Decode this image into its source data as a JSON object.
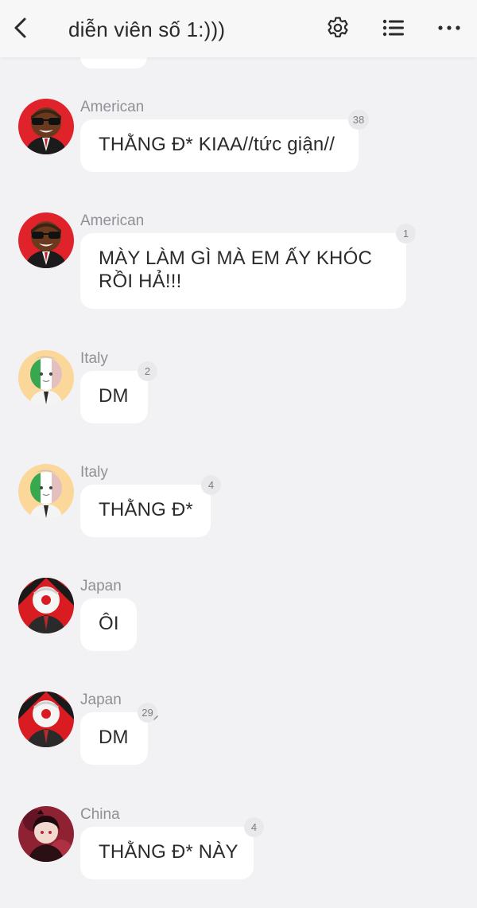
{
  "header": {
    "title": "diễn viên số 1:)))",
    "icons": [
      "back-arrow-icon",
      "gear-icon",
      "list-icon",
      "more-dots-icon"
    ]
  },
  "messages": [
    {
      "sender": "American",
      "text": "THẰNG Đ* KIAA//tức giận//",
      "badge": "38",
      "avatar": "american-avatar"
    },
    {
      "sender": "American",
      "text": "MÀY LÀM GÌ MÀ EM ẤY KHÓC RỒI HẢ!!!",
      "badge": "1",
      "avatar": "american-avatar"
    },
    {
      "sender": "Italy",
      "text": "DM",
      "badge": "2",
      "avatar": "italy-avatar"
    },
    {
      "sender": "Italy",
      "text": "THẰNG Đ*",
      "badge": "4",
      "avatar": "italy-avatar"
    },
    {
      "sender": "Japan",
      "text": "ÔI",
      "badge": "",
      "avatar": "japan-avatar"
    },
    {
      "sender": "Japan",
      "text": "DM",
      "badge": "29",
      "avatar": "japan-avatar"
    },
    {
      "sender": "China",
      "text": "THẰNG Đ* NÀY",
      "badge": "4",
      "avatar": "china-avatar"
    }
  ],
  "colors": {
    "background": "#f2f2f4",
    "bubble": "#ffffff",
    "sender": "#8f8f96",
    "badge_bg": "#e9e9ec"
  }
}
